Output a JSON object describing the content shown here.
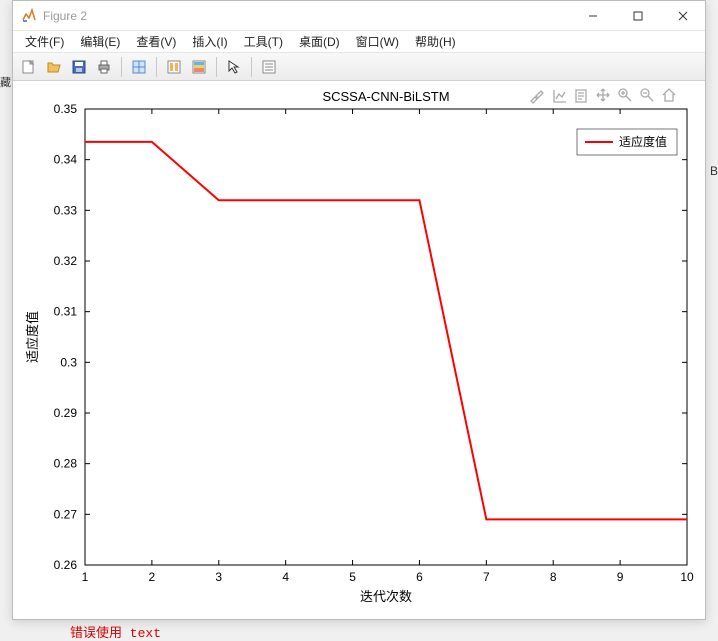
{
  "window": {
    "title": "Figure 2"
  },
  "menubar": {
    "file": "文件(F)",
    "edit": "编辑(E)",
    "view": "查看(V)",
    "insert": "插入(I)",
    "tools": "工具(T)",
    "desktop": "桌面(D)",
    "window_menu": "窗口(W)",
    "help": "帮助(H)"
  },
  "toolbar_icons": {
    "new": "new-figure-icon",
    "open": "open-icon",
    "save": "save-icon",
    "print": "print-icon",
    "datacursor": "data-cursor-icon",
    "link": "link-icon",
    "colorbar": "colorbar-icon",
    "legend": "legend-icon",
    "arrow": "arrow-icon",
    "property": "property-icon"
  },
  "figure_tool_icons": {
    "brush": "brush-icon",
    "edit": "edit-plot-icon",
    "notes": "notes-icon",
    "pan": "pan-icon",
    "zoomin": "zoom-in-icon",
    "zoomout": "zoom-out-icon",
    "home": "home-icon"
  },
  "chart_data": {
    "type": "line",
    "title": "SCSSA-CNN-BiLSTM",
    "xlabel": "迭代次数",
    "ylabel": "适应度值",
    "xlim": [
      1,
      10
    ],
    "ylim": [
      0.26,
      0.35
    ],
    "xticks": [
      1,
      2,
      3,
      4,
      5,
      6,
      7,
      8,
      9,
      10
    ],
    "yticks": [
      0.26,
      0.27,
      0.28,
      0.29,
      0.3,
      0.31,
      0.32,
      0.33,
      0.34,
      0.35
    ],
    "series": [
      {
        "name": "适应度值",
        "color": "#ff0000",
        "x": [
          1,
          2,
          3,
          4,
          5,
          6,
          7,
          8,
          9,
          10
        ],
        "y": [
          0.3435,
          0.3435,
          0.332,
          0.332,
          0.332,
          0.332,
          0.269,
          0.269,
          0.269,
          0.269
        ]
      }
    ],
    "legend_label": "适应度值"
  },
  "bottom_text": "错误使用  text"
}
